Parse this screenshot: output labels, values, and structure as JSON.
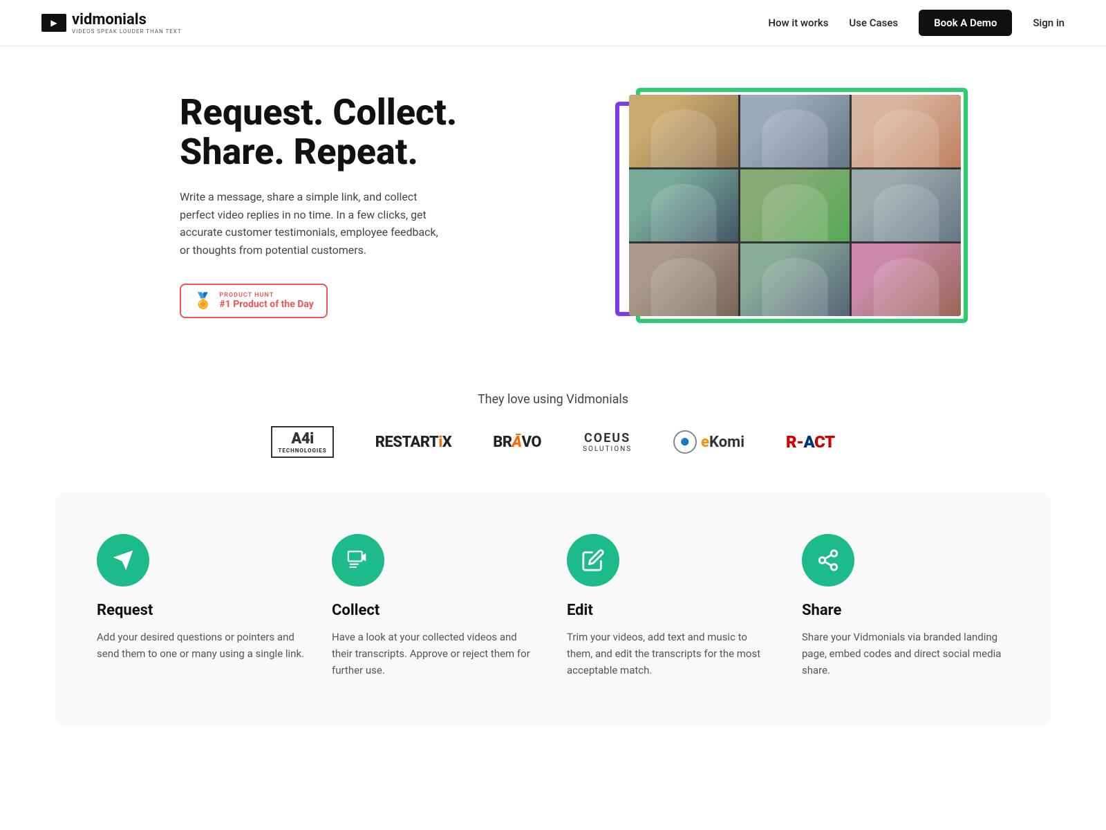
{
  "nav": {
    "logo_name": "vidmonials",
    "logo_tagline": "VIDEOS SPEAK LOUDER THAN TEXT",
    "links": [
      {
        "label": "How it works",
        "id": "how-it-works"
      },
      {
        "label": "Use Cases",
        "id": "use-cases"
      }
    ],
    "book_demo_label": "Book A Demo",
    "signin_label": "Sign in"
  },
  "hero": {
    "title": "Request. Collect. Share. Repeat.",
    "description": "Write a message, share a simple link, and collect perfect video replies in no time. In a few clicks, get accurate customer testimonials, employee feedback, or thoughts from potential customers.",
    "badge": {
      "label": "PRODUCT HUNT",
      "title": "#1 Product of the Day"
    }
  },
  "logos": {
    "title": "They love using Vidmonials",
    "brands": [
      {
        "name": "A4I TECHNOLOGIES",
        "id": "a4i"
      },
      {
        "name": "RESTARTIX",
        "id": "restartix"
      },
      {
        "name": "BRAVO",
        "id": "bravo"
      },
      {
        "name": "COEUS SOLUTIONS",
        "id": "coeus"
      },
      {
        "name": "eKomi",
        "id": "ekomi"
      },
      {
        "name": "R-ACT",
        "id": "react"
      }
    ]
  },
  "features": {
    "items": [
      {
        "id": "request",
        "title": "Request",
        "description": "Add your desired questions or pointers and send them to one or many using a single link.",
        "icon": "send"
      },
      {
        "id": "collect",
        "title": "Collect",
        "description": "Have a look at your collected videos and their transcripts. Approve or reject them for further use.",
        "icon": "collect"
      },
      {
        "id": "edit",
        "title": "Edit",
        "description": "Trim your videos, add text and music to them, and edit the transcripts for the most acceptable match.",
        "icon": "edit"
      },
      {
        "id": "share",
        "title": "Share",
        "description": "Share your Vidmonials via branded landing page, embed codes and direct social media share.",
        "icon": "share"
      }
    ]
  }
}
